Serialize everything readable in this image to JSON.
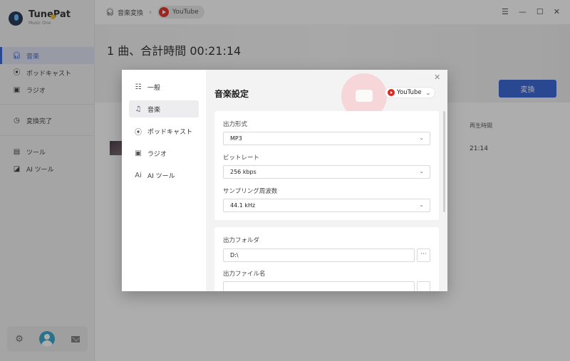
{
  "app": {
    "name": "TunePat",
    "subtitle": "Music One"
  },
  "sidebar": {
    "items": [
      {
        "label": "音楽",
        "icon": "headphones-icon"
      },
      {
        "label": "ポッドキャスト",
        "icon": "podcast-icon"
      },
      {
        "label": "ラジオ",
        "icon": "radio-icon"
      },
      {
        "label": "変換完了",
        "icon": "clock-icon"
      },
      {
        "label": "ツール",
        "icon": "toolbox-icon"
      },
      {
        "label": "AI ツール",
        "icon": "ai-icon"
      }
    ]
  },
  "breadcrumb": {
    "root": "音楽変換",
    "source": "YouTube"
  },
  "main": {
    "heading": "1 曲、合計時間 00:21:14",
    "convert_label": "変換",
    "duration_header": "再生時間",
    "row_duration": "21:14"
  },
  "modal": {
    "nav": [
      {
        "label": "一般",
        "icon": "sliders-icon"
      },
      {
        "label": "音楽",
        "icon": "music-note-icon"
      },
      {
        "label": "ポッドキャスト",
        "icon": "podcast-icon"
      },
      {
        "label": "ラジオ",
        "icon": "radio-icon"
      },
      {
        "label": "AI ツール",
        "icon": "ai-icon"
      }
    ],
    "title": "音楽設定",
    "source": "YouTube",
    "output_format_label": "出力形式",
    "output_format_value": "MP3",
    "bitrate_label": "ビットレート",
    "bitrate_value": "256 kbps",
    "sample_rate_label": "サンプリング周波数",
    "sample_rate_value": "44.1 kHz",
    "output_folder_label": "出力フォルダ",
    "output_folder_value": "D:\\",
    "output_filename_label": "出力ファイル名"
  },
  "colors": {
    "accent": "#2d5bd3",
    "youtube": "#e3261e"
  }
}
